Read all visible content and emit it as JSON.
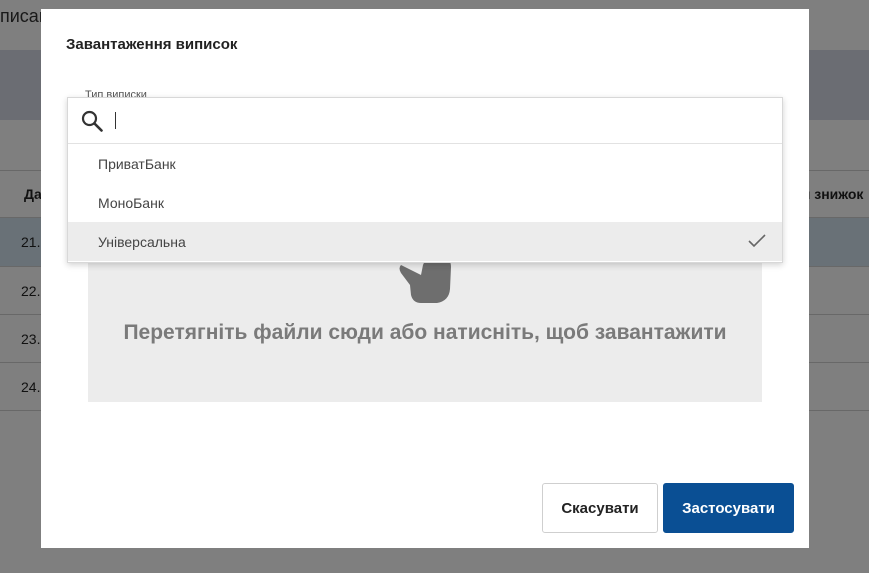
{
  "background": {
    "page_title": "писан",
    "table": {
      "header_first": "Да",
      "header_right": "м знижок",
      "rows": [
        "21.",
        "22.",
        "23.",
        "24."
      ]
    }
  },
  "modal": {
    "title": "Завантаження виписок",
    "field_label": "Тип виписки",
    "dropzone": {
      "icon": "hand-icon",
      "text": "Перетягніть файли сюди або натисніть, щоб завантажити"
    },
    "buttons": {
      "cancel_label": "Скасувати",
      "apply_label": "Застосувати"
    }
  },
  "dropdown": {
    "search": {
      "value": "",
      "placeholder": "",
      "icon": "search-icon"
    },
    "options": [
      {
        "label": "ПриватБанк",
        "selected": false
      },
      {
        "label": "МоноБанк",
        "selected": false
      },
      {
        "label": "Універсальна",
        "selected": true
      }
    ],
    "selected_icon": "checkmark-icon"
  },
  "colors": {
    "primary_button": "#0a4f94",
    "overlay": "rgba(0,0,0,0.5)",
    "selected_row": "#ececec",
    "dropzone_bg": "#ececec",
    "dropzone_text": "#7a7a7a"
  }
}
